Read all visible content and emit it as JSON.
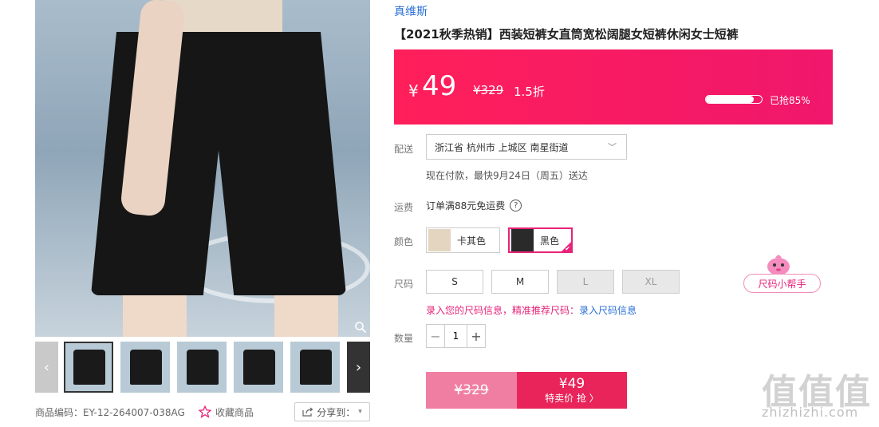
{
  "gallery": {
    "thumb_count": 5,
    "zoom_icon": "magnifier-icon"
  },
  "meta": {
    "product_code": "商品编码：EY-12-264007-038AG",
    "favorite_label": "收藏商品",
    "share_label": "分享到："
  },
  "product": {
    "brand": "真维斯",
    "title": "【2021秋季热销】西装短裤女直筒宽松阔腿女短裤休闲女士短裤"
  },
  "price": {
    "currency": "¥",
    "current": "49",
    "original": "¥329",
    "discount": "1.5折",
    "sold_label": "已抢85%",
    "sold_fraction": 0.85
  },
  "shipping_section": {
    "label": "配送",
    "address": "浙江省 杭州市 上城区 南星街道",
    "delivery_text": "现在付款，最快9月24日（周五）送达"
  },
  "freight": {
    "label": "运费",
    "text": "订单满88元免运费"
  },
  "color": {
    "label": "颜色",
    "options": [
      {
        "name": "卡其色",
        "swatch": "#d9c7ad",
        "selected": false
      },
      {
        "name": "黑色",
        "swatch": "#1a1a1a",
        "selected": true
      }
    ]
  },
  "size": {
    "label": "尺码",
    "options": [
      {
        "name": "S",
        "disabled": false
      },
      {
        "name": "M",
        "disabled": false
      },
      {
        "name": "L",
        "disabled": true
      },
      {
        "name": "XL",
        "disabled": true
      }
    ],
    "hint": "录入您的尺码信息，精准推荐尺码：",
    "hint_link": "录入尺码信息",
    "helper": "尺码小帮手"
  },
  "quantity": {
    "label": "数量",
    "value": "1"
  },
  "buy": {
    "original": "¥329",
    "price": "¥49",
    "action": "特卖价 抢 〉"
  },
  "watermark": {
    "logo": "值值值",
    "url": "zhizhizhi.com"
  },
  "colors": {
    "accent": "#e8237a",
    "price_band": "#ff1f5a",
    "link": "#2b6fd6"
  }
}
